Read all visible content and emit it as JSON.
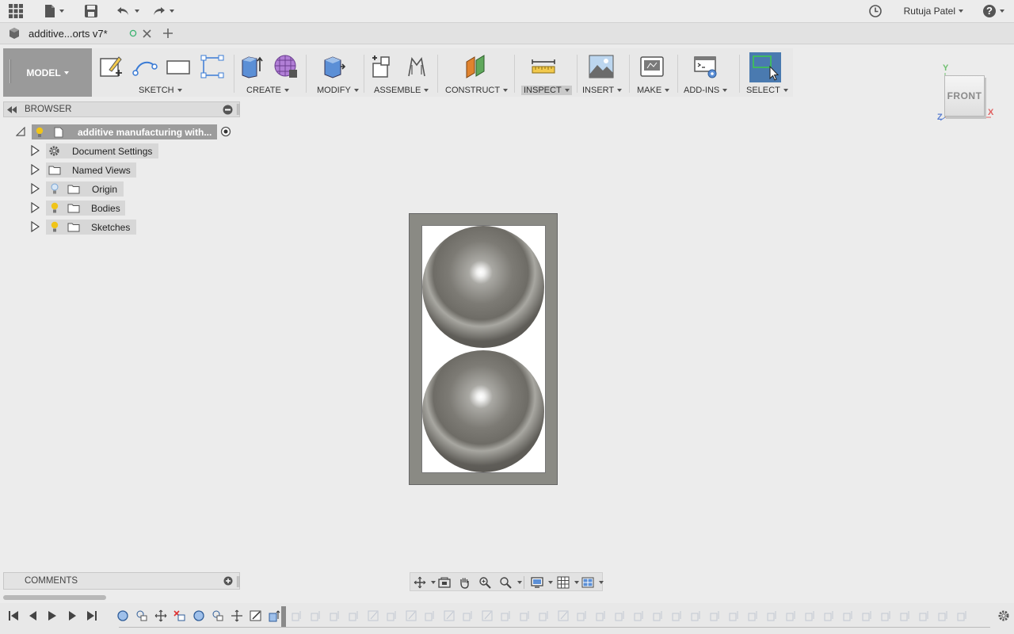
{
  "app": {
    "user_name": "Rutuja Patel",
    "help_label": "?"
  },
  "tab": {
    "title": "additive...orts v7*"
  },
  "toolbar": {
    "workspace": "MODEL",
    "groups": {
      "sketch": "SKETCH",
      "create": "CREATE",
      "modify": "MODIFY",
      "assemble": "ASSEMBLE",
      "construct": "CONSTRUCT",
      "inspect": "INSPECT",
      "insert": "INSERT",
      "make": "MAKE",
      "addins": "ADD-INS",
      "select": "SELECT"
    }
  },
  "browser": {
    "title": "BROWSER",
    "root_label": "additive manufacturing with...",
    "items": [
      {
        "label": "Document Settings"
      },
      {
        "label": "Named Views"
      },
      {
        "label": "Origin"
      },
      {
        "label": "Bodies"
      },
      {
        "label": "Sketches"
      }
    ]
  },
  "viewcube": {
    "face": "FRONT",
    "axis_y": "Y",
    "axis_x": "X",
    "axis_z": "Z"
  },
  "comments": {
    "title": "COMMENTS"
  },
  "colors": {
    "accent_select": "#4a7ab0",
    "bulb_on": "#f0c419",
    "bulb_off": "#9fbfe0",
    "axis_x": "#e06060",
    "axis_y": "#70c070",
    "axis_z": "#5b7fd0"
  }
}
